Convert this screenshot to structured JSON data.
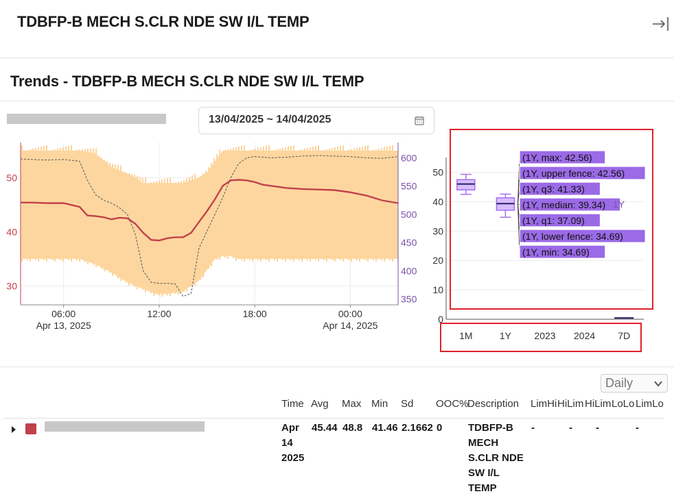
{
  "header": {
    "title": "TDBFP-B MECH S.CLR NDE SW I/L TEMP",
    "exit_icon": "exit-icon"
  },
  "section": {
    "title": "Trends - TDBFP-B MECH S.CLR NDE SW I/L TEMP"
  },
  "date_range": {
    "value": "13/04/2025 ~ 14/04/2025",
    "icon": "calendar-icon"
  },
  "chart_data": [
    {
      "type": "line",
      "title": "",
      "x_ticks": [
        {
          "line1": "06:00",
          "line2": "Apr 13, 2025",
          "hour": 6
        },
        {
          "line1": "12:00",
          "line2": "",
          "hour": 12
        },
        {
          "line1": "18:00",
          "line2": "",
          "hour": 18
        },
        {
          "line1": "00:00",
          "line2": "Apr 14, 2025",
          "hour": 24
        }
      ],
      "xlim_hours": [
        3.3,
        27.0
      ],
      "y_left": {
        "ticks": [
          30,
          40,
          50
        ],
        "lim": [
          26.5,
          56.5
        ],
        "color": "#c1414b"
      },
      "y_right": {
        "ticks": [
          350,
          400,
          450,
          500,
          550,
          600
        ],
        "lim": [
          340,
          627
        ],
        "color": "#7b52ab"
      },
      "series": [
        {
          "name": "",
          "axis": "left",
          "color": "#c1414b",
          "style": "solid",
          "x": [
            3.3,
            4.0,
            5.0,
            6.0,
            7.0,
            7.5,
            8.0,
            8.5,
            9.0,
            9.5,
            10.0,
            10.5,
            11.0,
            11.5,
            12.0,
            12.5,
            13.0,
            13.5,
            14.0,
            14.5,
            15.0,
            15.5,
            16.0,
            16.5,
            17.0,
            17.5,
            18.0,
            18.5,
            19.0,
            20.0,
            21.0,
            22.0,
            23.0,
            24.0,
            25.0,
            26.0,
            27.0
          ],
          "values": [
            45.4,
            45.4,
            45.3,
            45.3,
            44.6,
            43.0,
            42.9,
            42.7,
            42.3,
            42.6,
            42.5,
            41.5,
            39.8,
            38.5,
            38.4,
            38.8,
            39.0,
            39.0,
            39.8,
            41.8,
            43.8,
            46.0,
            48.5,
            49.5,
            49.6,
            49.5,
            49.2,
            48.7,
            48.5,
            48.1,
            47.9,
            47.8,
            47.7,
            47.3,
            46.7,
            45.8,
            45.3
          ]
        },
        {
          "name": "",
          "axis": "right",
          "color": "#555555",
          "style": "dashed",
          "x": [
            3.3,
            4.0,
            5.0,
            6.0,
            7.0,
            7.5,
            8.0,
            8.5,
            9.0,
            9.5,
            10.0,
            10.5,
            11.0,
            11.5,
            12.0,
            12.5,
            13.0,
            13.5,
            14.0,
            14.5,
            15.0,
            15.5,
            16.0,
            16.5,
            17.0,
            17.5,
            18.0,
            19.0,
            20.0,
            21.0,
            22.0,
            23.0,
            24.0,
            25.0,
            26.0,
            27.0
          ],
          "values": [
            598,
            597,
            596,
            597,
            594,
            560,
            535,
            525,
            520,
            512,
            500,
            465,
            400,
            380,
            378,
            378,
            377,
            355,
            360,
            440,
            470,
            500,
            530,
            565,
            590,
            600,
            602,
            600,
            601,
            603,
            604,
            603,
            602,
            600,
            599,
            602
          ]
        },
        {
          "name": "",
          "type": "band",
          "axis": "left",
          "color": "#fdd49a",
          "x": [
            3.3,
            6.0,
            7.0,
            8.0,
            9.0,
            9.8,
            10.5,
            11.0,
            11.8,
            12.5,
            13.5,
            14.5,
            15.0,
            15.5,
            16.0,
            16.5,
            17.0,
            18.0,
            20.0,
            22.0,
            24.0,
            27.0
          ],
          "upper": [
            55,
            55,
            55,
            54.5,
            52,
            51,
            50,
            49,
            49,
            49,
            49,
            50,
            51,
            53,
            55,
            55,
            55,
            55,
            55,
            55,
            55,
            55
          ],
          "lower": [
            35,
            35,
            35,
            34,
            32.5,
            31,
            30,
            29.5,
            28.5,
            28.5,
            29,
            31,
            33,
            35,
            35.5,
            35.5,
            35,
            35,
            35,
            35,
            35,
            35
          ]
        }
      ]
    },
    {
      "type": "box",
      "title": "",
      "categories": [
        "1M",
        "1Y",
        "2023",
        "2024",
        "7D"
      ],
      "y_ticks": [
        0,
        10,
        20,
        30,
        40,
        50
      ],
      "ylim": [
        0,
        55
      ],
      "series": [
        {
          "name": "",
          "color": "#a56ff0",
          "boxes": [
            {
              "category": "1M",
              "min": 42.5,
              "q1": 44.0,
              "median": 46.0,
              "q3": 47.5,
              "max": 49.3,
              "upper_fence": 49.3,
              "lower_fence": 42.5
            },
            {
              "category": "1Y",
              "min": 34.69,
              "lower_fence": 34.69,
              "q1": 37.09,
              "median": 39.34,
              "q3": 41.33,
              "upper_fence": 42.56,
              "max": 42.56
            },
            {
              "category": "7D",
              "min": 0.2,
              "q1": 0.2,
              "median": 0.2,
              "q3": 0.2,
              "max": 0.2
            }
          ]
        }
      ],
      "tooltip": {
        "label": "1Y",
        "lines": [
          "(1Y, max: 42.56)",
          "(1Y, upper fence: 42.56)",
          "(1Y, q3: 41.33)",
          "(1Y, median: 39.34)",
          "(1Y, q1: 37.09)",
          "(1Y, lower fence: 34.69)",
          "(1Y, min: 34.69)"
        ]
      }
    }
  ],
  "table": {
    "period_select": "Daily",
    "headers": [
      "Time",
      "Avg",
      "Max",
      "Min",
      "Sd",
      "OOC%",
      "Description",
      "LimHi",
      "HiLim",
      "HiLim",
      "LoLo",
      "LimLo"
    ],
    "row": {
      "color": "#c1414b",
      "time": "Apr 14 2025",
      "avg": "45.44",
      "max": "48.8",
      "min": "41.46",
      "sd": "2.1662",
      "ooc": "0",
      "description": "TDBFP-B MECH S.CLR NDE SW I/L TEMP",
      "lim1": "-",
      "lim2": "-",
      "lim3": "-",
      "lim4": "-"
    }
  }
}
